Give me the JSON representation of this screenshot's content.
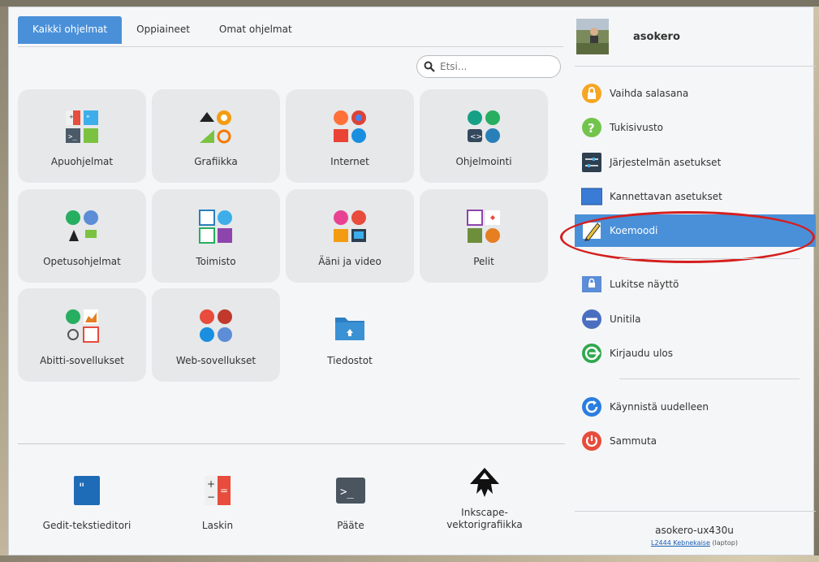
{
  "tabs": [
    {
      "label": "Kaikki ohjelmat"
    },
    {
      "label": "Oppiaineet"
    },
    {
      "label": "Omat ohjelmat"
    }
  ],
  "search": {
    "placeholder": "Etsi..."
  },
  "categories": [
    {
      "label": "Apuohjelmat",
      "icon": "accessories-icon"
    },
    {
      "label": "Grafiikka",
      "icon": "graphics-icon"
    },
    {
      "label": "Internet",
      "icon": "internet-icon"
    },
    {
      "label": "Ohjelmointi",
      "icon": "programming-icon"
    },
    {
      "label": "Opetusohjelmat",
      "icon": "education-icon"
    },
    {
      "label": "Toimisto",
      "icon": "office-icon"
    },
    {
      "label": "Ääni ja video",
      "icon": "audio-video-icon"
    },
    {
      "label": "Pelit",
      "icon": "games-icon"
    },
    {
      "label": "Abitti-sovellukset",
      "icon": "abitti-icon"
    },
    {
      "label": "Web-sovellukset",
      "icon": "web-apps-icon"
    },
    {
      "label": "Tiedostot",
      "icon": "folder-icon"
    }
  ],
  "favorites": [
    {
      "label": "Gedit-tekstieditori",
      "icon": "gedit-icon"
    },
    {
      "label": "Laskin",
      "icon": "calculator-icon"
    },
    {
      "label": "Pääte",
      "icon": "terminal-icon"
    },
    {
      "label_line1": "Inkscape-",
      "label_line2": "vektorigrafiikka",
      "icon": "inkscape-icon"
    }
  ],
  "user": {
    "name": "asokero"
  },
  "actions": [
    {
      "label": "Vaihda salasana",
      "icon": "lock-icon"
    },
    {
      "label": "Tukisivusto",
      "icon": "help-icon"
    },
    {
      "label": "Järjestelmän asetukset",
      "icon": "system-settings-icon"
    },
    {
      "label": "Kannettavan asetukset",
      "icon": "laptop-settings-icon"
    },
    {
      "label": "Koemoodi",
      "icon": "exam-mode-icon",
      "selected": true
    },
    {
      "label": "Lukitse näyttö",
      "icon": "lock-screen-icon"
    },
    {
      "label": "Unitila",
      "icon": "sleep-icon"
    },
    {
      "label": "Kirjaudu ulos",
      "icon": "logout-icon"
    },
    {
      "label": "Käynnistä uudelleen",
      "icon": "restart-icon"
    },
    {
      "label": "Sammuta",
      "icon": "shutdown-icon"
    }
  ],
  "host": {
    "name": "asokero-ux430u",
    "link": "L2444 Kebnekaise",
    "type": "(laptop)"
  },
  "colors": {
    "accent": "#4a90d9",
    "highlight_ring": "#d51e1e"
  }
}
